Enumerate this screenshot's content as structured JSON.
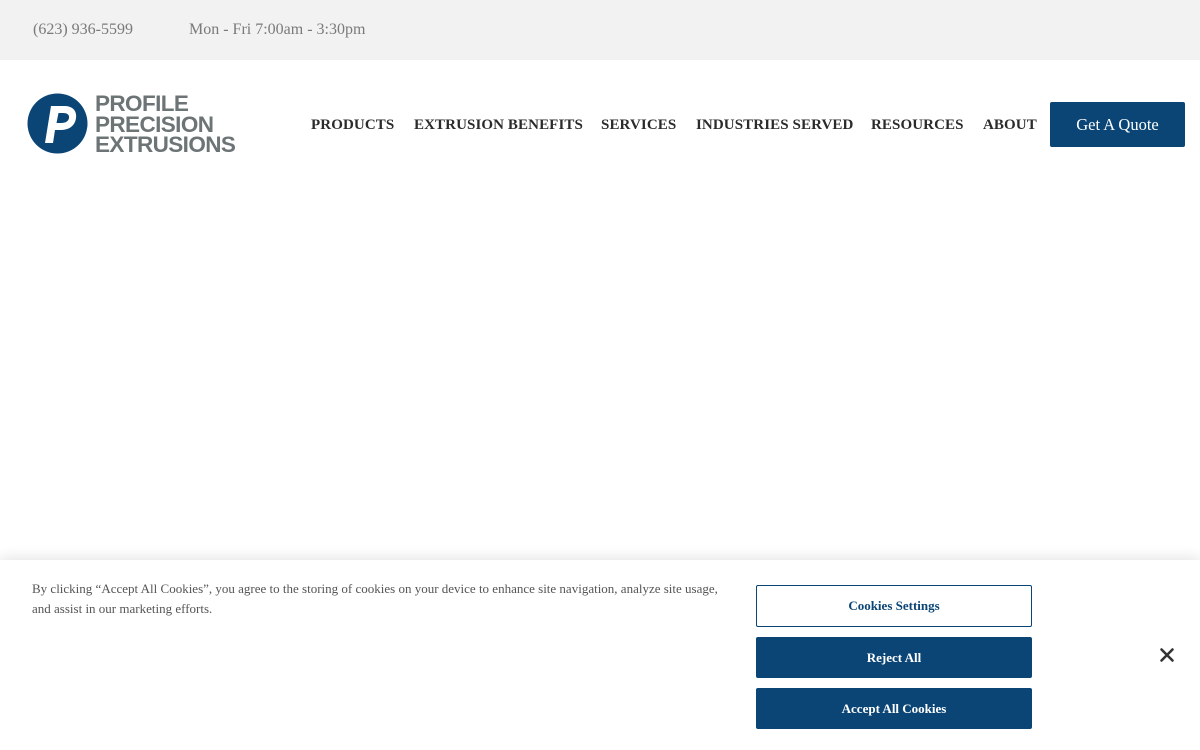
{
  "topbar": {
    "phone": "(623) 936-5599",
    "hours": "Mon - Fri 7:00am - 3:30pm"
  },
  "brand": {
    "line1": "PROFILE",
    "line2": "PRECISION",
    "line3": "EXTRUSIONS",
    "mark_letter": "P",
    "mark_color": "#0a4576",
    "text_color": "#6d7476"
  },
  "nav": {
    "items": [
      {
        "label": "PRODUCTS"
      },
      {
        "label": "EXTRUSION BENEFITS"
      },
      {
        "label": "SERVICES"
      },
      {
        "label": "INDUSTRIES SERVED"
      },
      {
        "label": "RESOURCES"
      },
      {
        "label": "ABOUT"
      }
    ],
    "cta_label": "Get A Quote"
  },
  "cookie_banner": {
    "text": "By clicking “Accept All Cookies”, you agree to the storing of cookies on your device to enhance site navigation, analyze site usage, and assist in our marketing efforts.",
    "settings_label": "Cookies Settings",
    "reject_label": "Reject All",
    "accept_label": "Accept All Cookies",
    "close_icon": "close-icon"
  },
  "colors": {
    "accent": "#0a4576",
    "topbar_bg": "#f2f2f2"
  }
}
